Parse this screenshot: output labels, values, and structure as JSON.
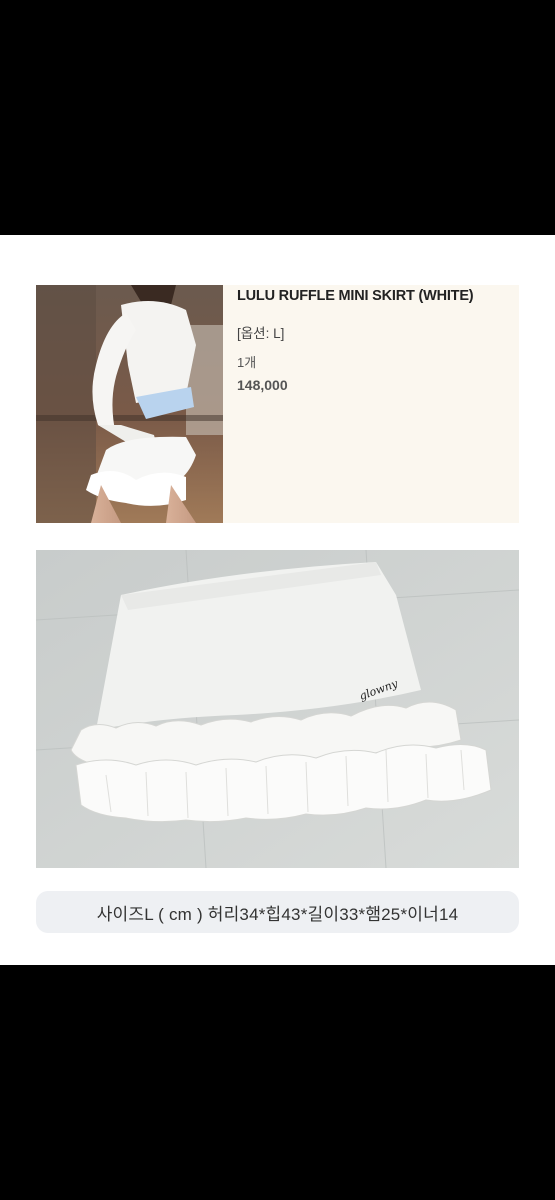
{
  "order": {
    "title": "LULU RUFFLE MINI SKIRT (WHITE)",
    "option": "[옵션: L]",
    "quantity": "1개",
    "price": "148,000"
  },
  "caption": "사이즈L ( cm ) 허리34*힙43*길이33*햄25*이너14",
  "colors": {
    "card_background": "#fbf7ef",
    "bubble_background": "#eef0f3",
    "page_background": "#ffffff"
  }
}
